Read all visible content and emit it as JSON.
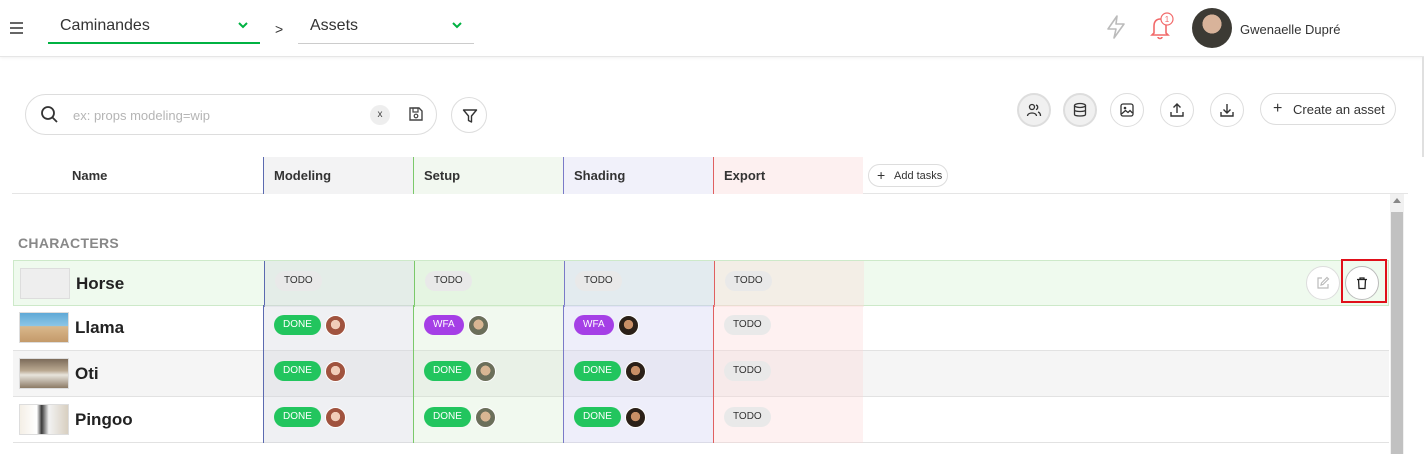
{
  "header": {
    "production": "Caminandes",
    "breadcrumb_sep": ">",
    "entity_type": "Assets",
    "notification_count": "1",
    "user_name": "Gwenaelle Dupré"
  },
  "search": {
    "placeholder": "ex: props modeling=wip",
    "clear_label": "x"
  },
  "toolbar": {
    "create_label": "Create an asset",
    "create_plus": "+"
  },
  "table": {
    "columns": {
      "name": "Name",
      "modeling": "Modeling",
      "setup": "Setup",
      "shading": "Shading",
      "export": "Export"
    },
    "add_tasks_label": "Add tasks",
    "add_tasks_plus": "+",
    "group": "CHARACTERS",
    "rows": [
      {
        "name": "Horse",
        "modeling": "TODO",
        "setup": "TODO",
        "shading": "TODO",
        "export": "TODO"
      },
      {
        "name": "Llama",
        "modeling": "DONE",
        "setup": "WFA",
        "shading": "WFA",
        "export": "TODO"
      },
      {
        "name": "Oti",
        "modeling": "DONE",
        "setup": "DONE",
        "shading": "DONE",
        "export": "TODO"
      },
      {
        "name": "Pingoo",
        "modeling": "DONE",
        "setup": "DONE",
        "shading": "DONE",
        "export": "TODO"
      }
    ]
  },
  "colors": {
    "accent": "#00b242",
    "done": "#22c55e",
    "wfa": "#a53fe6",
    "todo": "#e9e9e9",
    "highlight": "#e0101a"
  }
}
